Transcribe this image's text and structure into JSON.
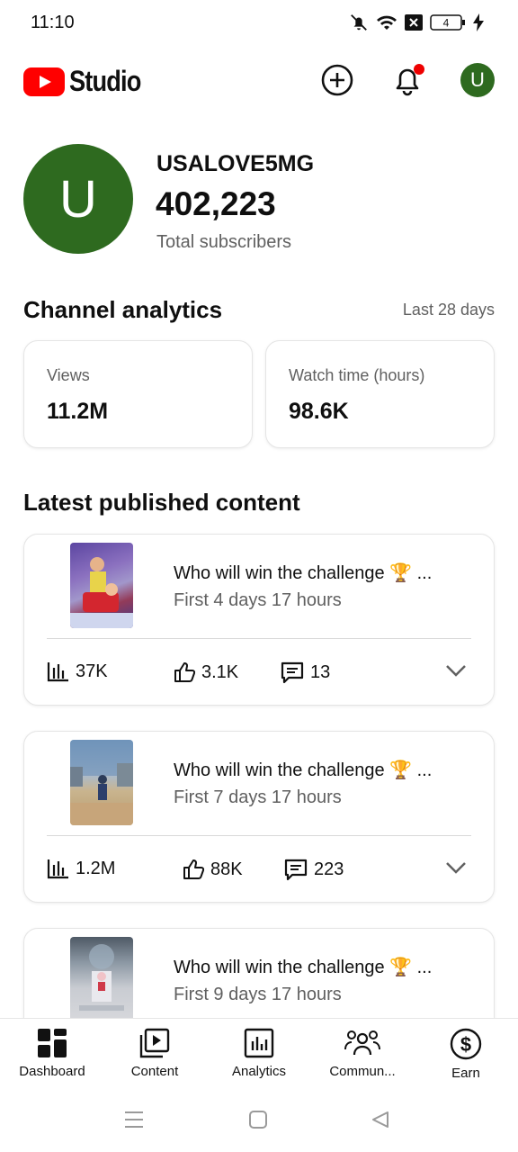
{
  "status_bar": {
    "time": "11:10",
    "battery": "4"
  },
  "app": {
    "logo_text": "Studio"
  },
  "channel": {
    "initial": "U",
    "name": "USALOVE5MG",
    "subscribers": "402,223",
    "subscribers_label": "Total subscribers"
  },
  "analytics": {
    "title": "Channel analytics",
    "period": "Last 28 days",
    "metrics": [
      {
        "label": "Views",
        "value": "11.2M"
      },
      {
        "label": "Watch time (hours)",
        "value": "98.6K"
      }
    ]
  },
  "latest": {
    "title": "Latest published content",
    "videos": [
      {
        "title": "Who will win the challenge 🏆 ...",
        "subtitle": "First 4 days 17 hours",
        "views": "37K",
        "likes": "3.1K",
        "comments": "13"
      },
      {
        "title": "Who will win the challenge 🏆 ...",
        "subtitle": "First 7 days 17 hours",
        "views": "1.2M",
        "likes": "88K",
        "comments": "223"
      },
      {
        "title": "Who will win the challenge 🏆 ...",
        "subtitle": "First 9 days 17 hours",
        "views": "",
        "likes": "",
        "comments": ""
      }
    ]
  },
  "bottom_nav": [
    {
      "label": "Dashboard",
      "icon": "dashboard-icon",
      "active": true
    },
    {
      "label": "Content",
      "icon": "content-icon"
    },
    {
      "label": "Analytics",
      "icon": "analytics-icon"
    },
    {
      "label": "Commun...",
      "icon": "community-icon"
    },
    {
      "label": "Earn",
      "icon": "earn-icon"
    }
  ],
  "colors": {
    "brand_red": "#ff0000",
    "avatar_green": "#2e6a1f",
    "notification_red": "#e00000",
    "secondary_text": "#606060"
  }
}
